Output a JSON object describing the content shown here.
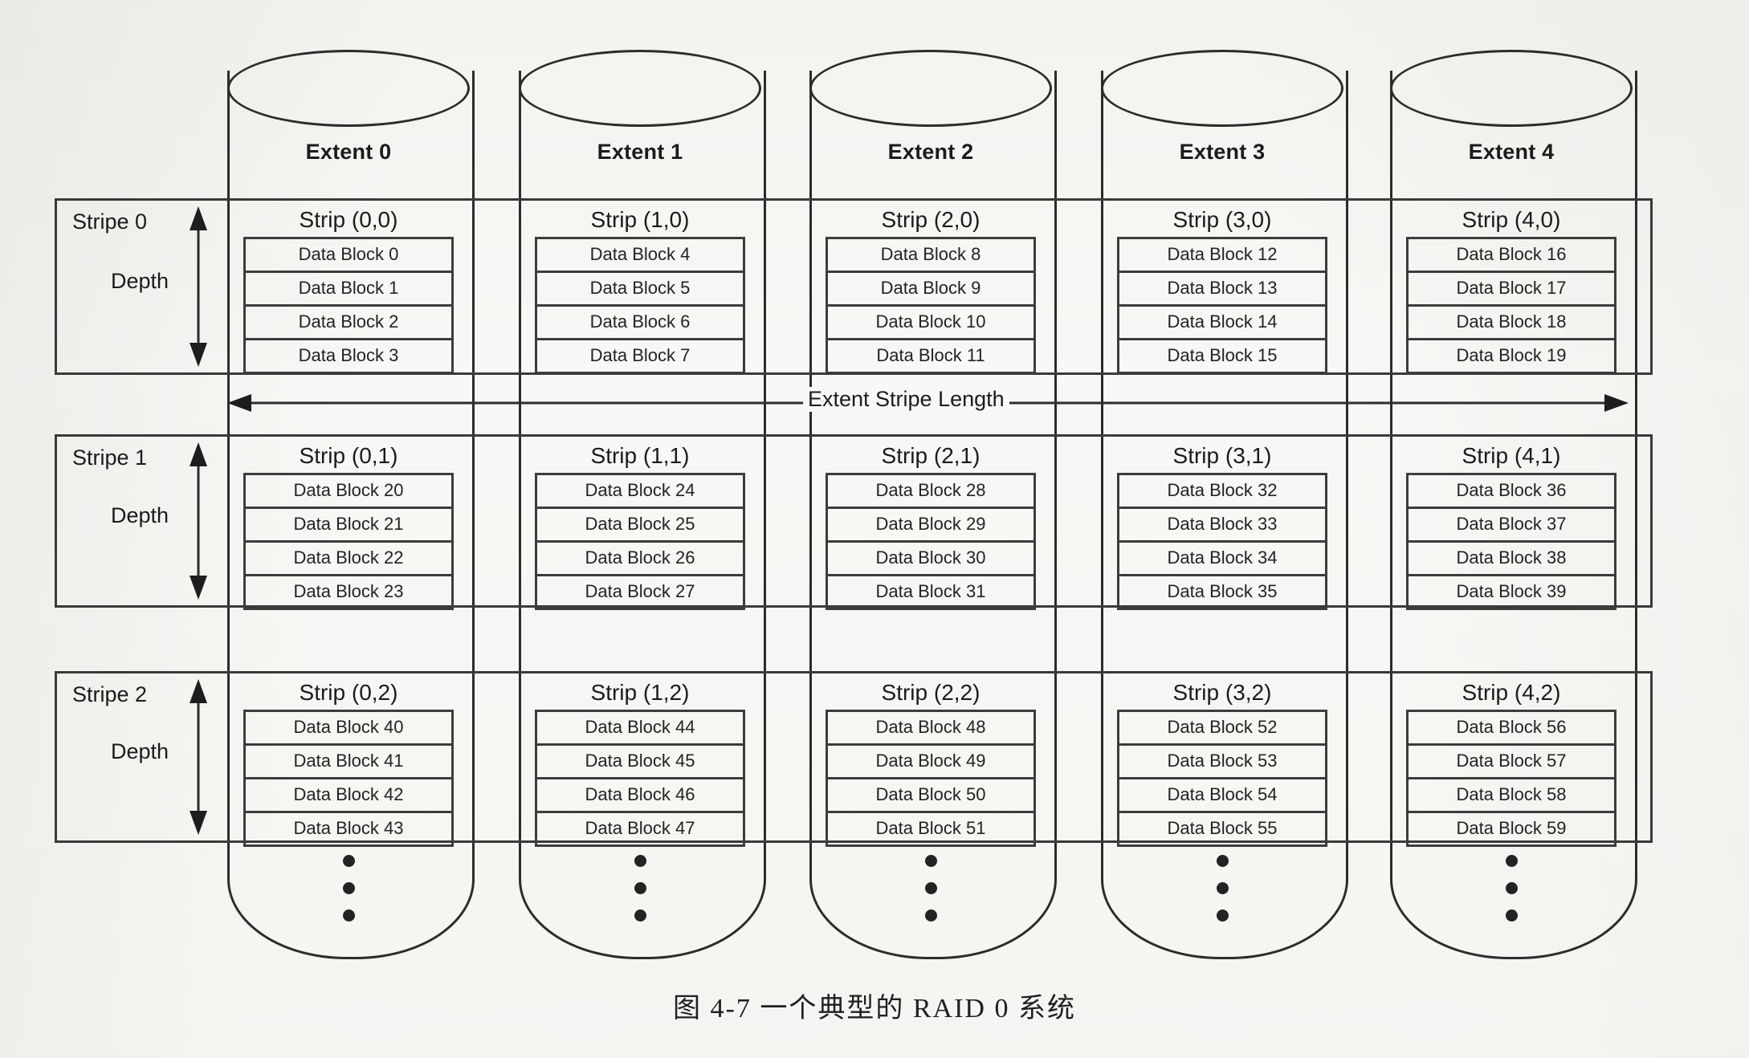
{
  "figure": {
    "caption": "图 4-7   一个典型的 RAID 0 系统",
    "extent_stripe_length_label": "Extent Stripe Length",
    "depth_label": "Depth",
    "vertical_ellipsis": "•"
  },
  "colors": {
    "ink": "#2c2c2c",
    "paper": "#f7f6f4",
    "rule": "#3c3c3c"
  },
  "extents": [
    {
      "label": "Extent 0"
    },
    {
      "label": "Extent 1"
    },
    {
      "label": "Extent 2"
    },
    {
      "label": "Extent 3"
    },
    {
      "label": "Extent 4"
    }
  ],
  "stripes": [
    {
      "label": "Stripe 0",
      "strips": [
        {
          "title": "Strip (0,0)",
          "blocks": [
            "Data Block 0",
            "Data Block 1",
            "Data Block 2",
            "Data Block 3"
          ]
        },
        {
          "title": "Strip (1,0)",
          "blocks": [
            "Data Block 4",
            "Data Block 5",
            "Data Block 6",
            "Data Block 7"
          ]
        },
        {
          "title": "Strip (2,0)",
          "blocks": [
            "Data Block 8",
            "Data Block 9",
            "Data Block 10",
            "Data Block 11"
          ]
        },
        {
          "title": "Strip (3,0)",
          "blocks": [
            "Data Block 12",
            "Data Block 13",
            "Data Block 14",
            "Data Block 15"
          ]
        },
        {
          "title": "Strip (4,0)",
          "blocks": [
            "Data Block 16",
            "Data Block 17",
            "Data Block 18",
            "Data Block 19"
          ]
        }
      ]
    },
    {
      "label": "Stripe 1",
      "strips": [
        {
          "title": "Strip (0,1)",
          "blocks": [
            "Data Block 20",
            "Data Block 21",
            "Data Block 22",
            "Data Block 23"
          ]
        },
        {
          "title": "Strip (1,1)",
          "blocks": [
            "Data Block 24",
            "Data Block 25",
            "Data Block 26",
            "Data Block 27"
          ]
        },
        {
          "title": "Strip (2,1)",
          "blocks": [
            "Data Block 28",
            "Data Block 29",
            "Data Block 30",
            "Data Block 31"
          ]
        },
        {
          "title": "Strip (3,1)",
          "blocks": [
            "Data Block 32",
            "Data Block 33",
            "Data Block 34",
            "Data Block 35"
          ]
        },
        {
          "title": "Strip (4,1)",
          "blocks": [
            "Data Block 36",
            "Data Block 37",
            "Data Block 38",
            "Data Block 39"
          ]
        }
      ]
    },
    {
      "label": "Stripe 2",
      "strips": [
        {
          "title": "Strip (0,2)",
          "blocks": [
            "Data Block 40",
            "Data Block 41",
            "Data Block 42",
            "Data Block 43"
          ]
        },
        {
          "title": "Strip (1,2)",
          "blocks": [
            "Data Block 44",
            "Data Block 45",
            "Data Block 46",
            "Data Block 47"
          ]
        },
        {
          "title": "Strip (2,2)",
          "blocks": [
            "Data Block 48",
            "Data Block 49",
            "Data Block 50",
            "Data Block 51"
          ]
        },
        {
          "title": "Strip (3,2)",
          "blocks": [
            "Data Block 52",
            "Data Block 53",
            "Data Block 54",
            "Data Block 55"
          ]
        },
        {
          "title": "Strip (4,2)",
          "blocks": [
            "Data Block 56",
            "Data Block 57",
            "Data Block 58",
            "Data Block 59"
          ]
        }
      ]
    }
  ]
}
